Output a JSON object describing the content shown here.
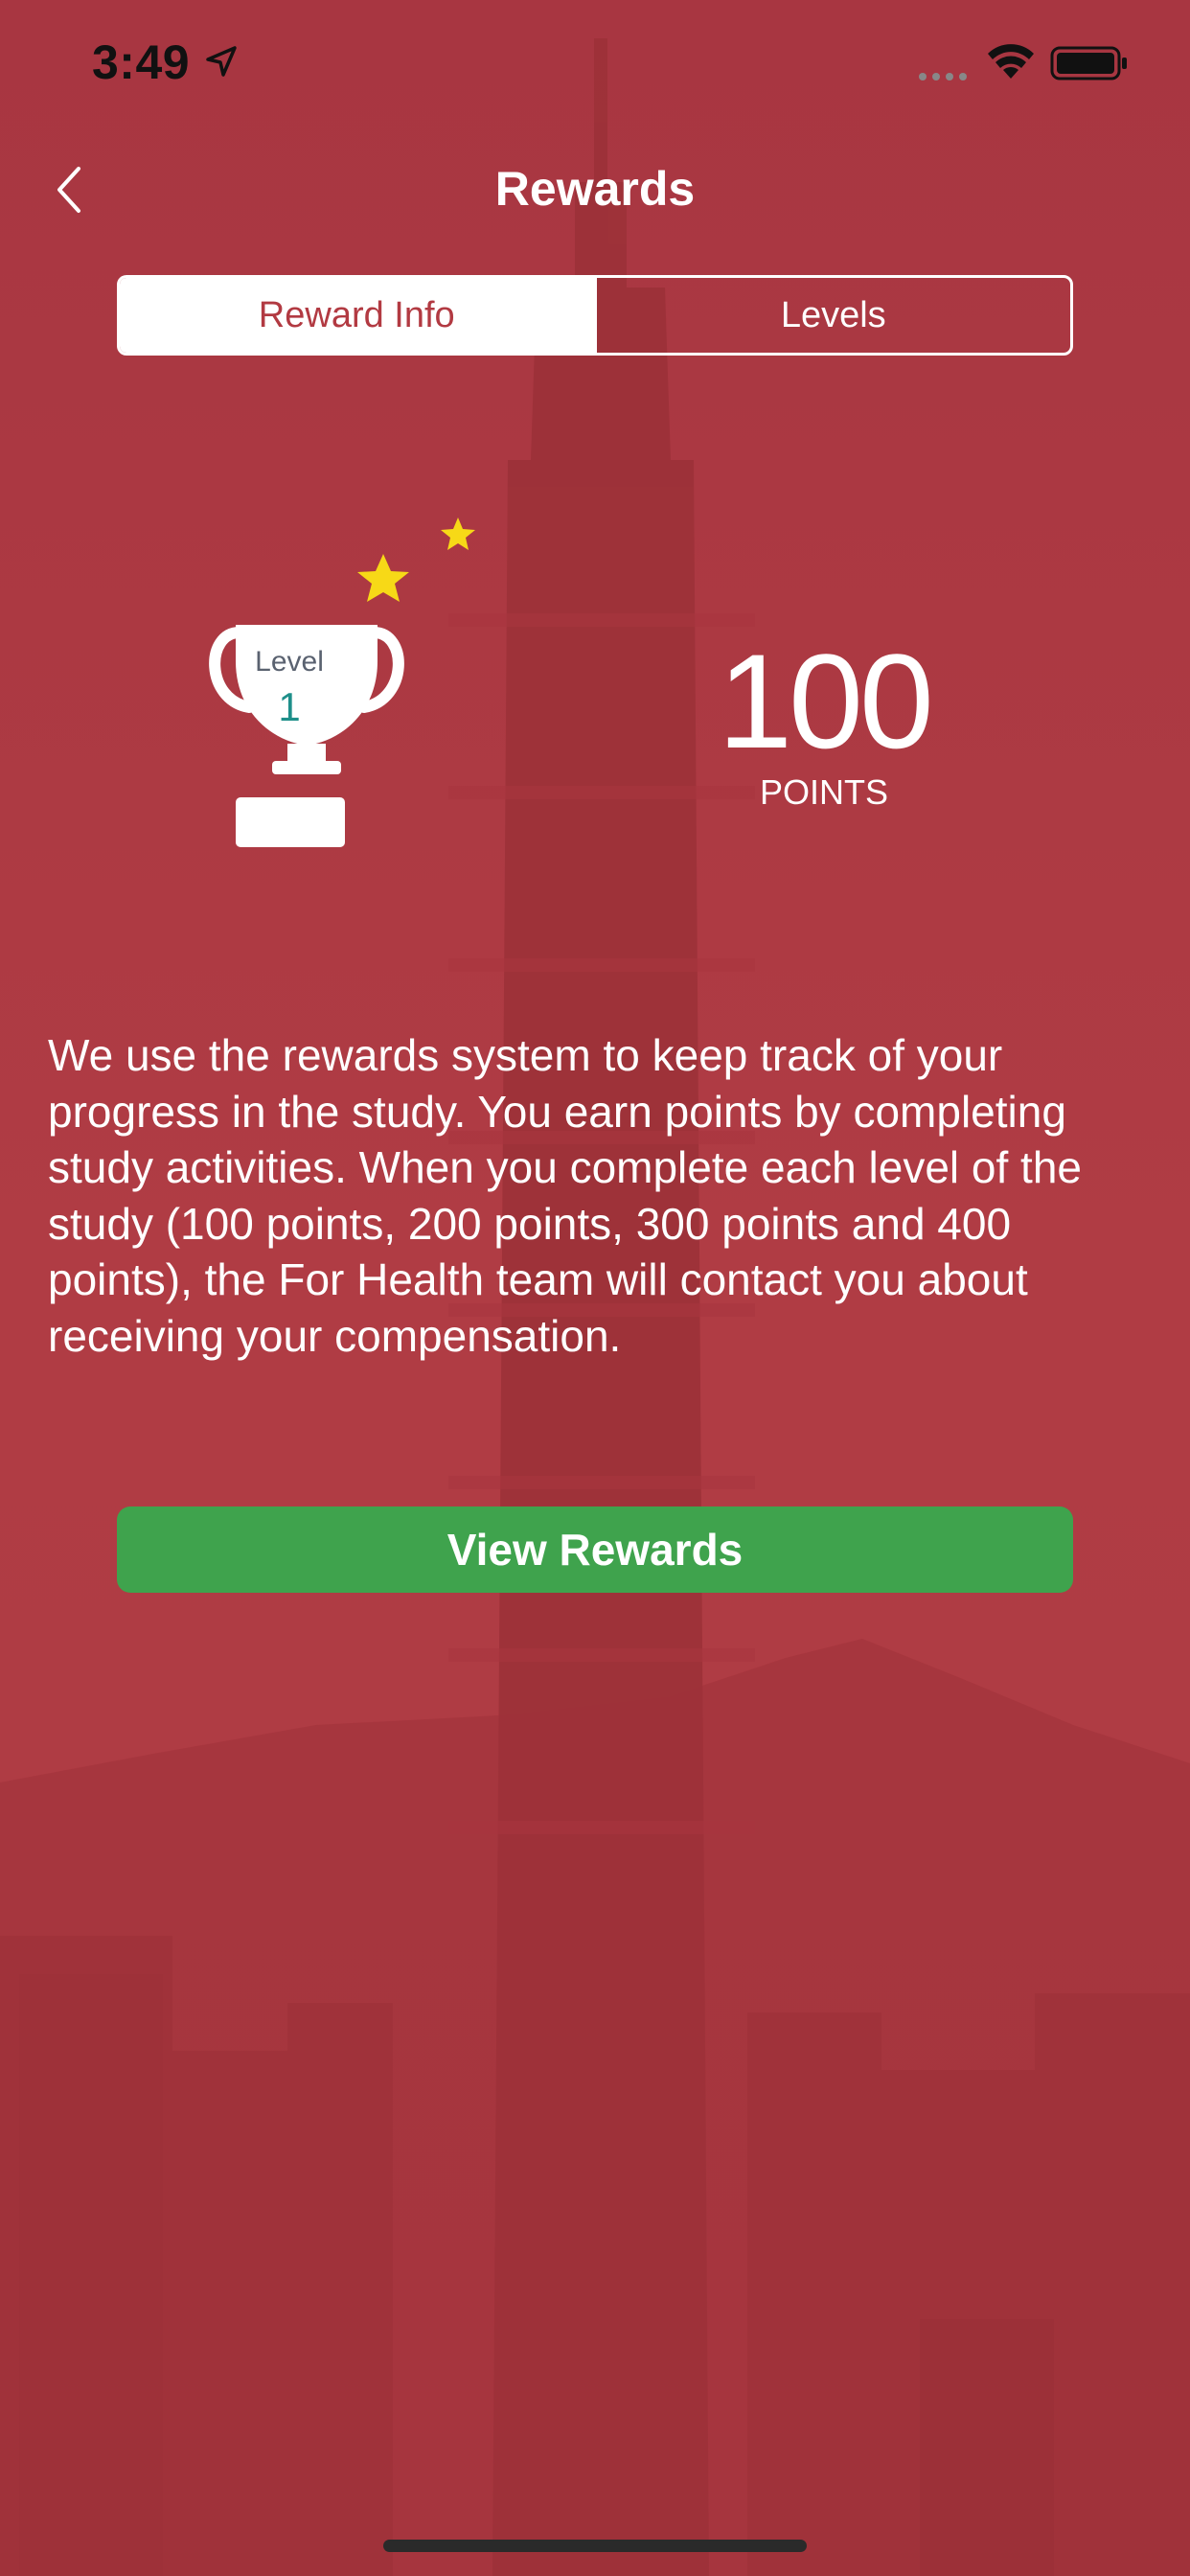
{
  "status_bar": {
    "time": "3:49",
    "icons": [
      "location-arrow-icon",
      "cellular-signal-icon",
      "wifi-icon",
      "battery-icon"
    ]
  },
  "nav": {
    "title": "Rewards",
    "back_icon": "chevron-left-icon"
  },
  "segmented": {
    "tabs": [
      {
        "label": "Reward Info",
        "selected": true
      },
      {
        "label": "Levels",
        "selected": false
      }
    ]
  },
  "reward": {
    "level_label": "Level",
    "level_value": "1",
    "points_value": "100",
    "points_label": "POINTS",
    "icons": [
      "trophy-icon",
      "star-icon",
      "star-icon"
    ]
  },
  "description": "We use the rewards system to keep track of your progress in the study. You earn points by completing study activities. When you complete each level of the study (100 points, 200 points, 300 points and 400 points), the For Health team will contact you about receiving your compensation.",
  "actions": {
    "view_rewards_label": "View Rewards"
  },
  "colors": {
    "background": "#b23a42",
    "accent_green": "#3fa34d",
    "star_yellow": "#f7d917",
    "teal": "#1e8f8a"
  }
}
